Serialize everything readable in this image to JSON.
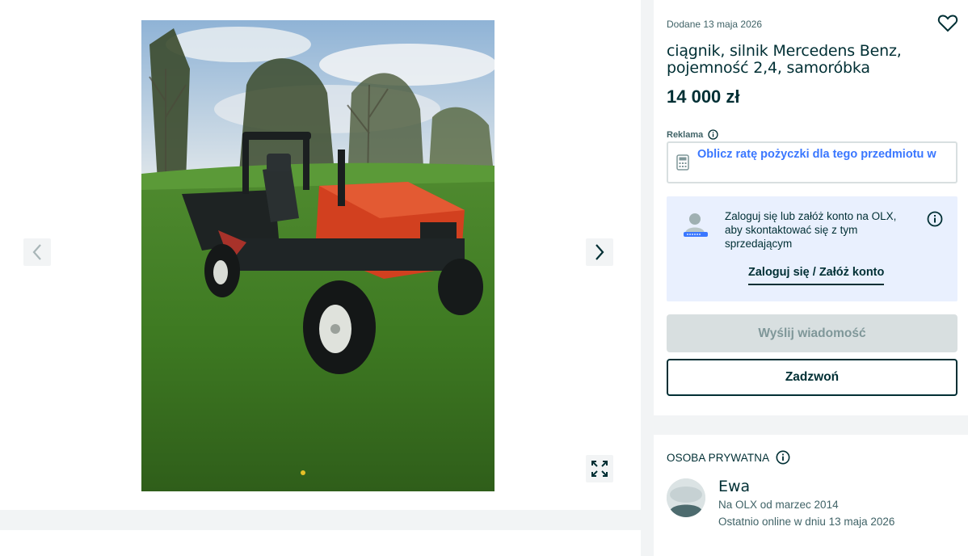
{
  "listing": {
    "posted": "Dodane 13 maja 2026",
    "title": "ciągnik, silnik Mercedens Benz, pojemność 2,4, samoróbka",
    "price": "14 000 zł"
  },
  "gallery": {
    "photo_icon": "tractor-photo",
    "prev_icon": "chevron-left-icon",
    "next_icon": "chevron-right-icon",
    "fullscreen_icon": "expand-icon"
  },
  "ad": {
    "label": "Reklama",
    "text": "Oblicz ratę pożyczki dla tego przedmiotu w"
  },
  "login_prompt": {
    "message": "Zaloguj się lub załóż konto na OLX, aby skontaktować się z tym sprzedającym",
    "link": "Zaloguj się / Załóż konto"
  },
  "actions": {
    "send_message": "Wyślij wiadomość",
    "call": "Zadzwoń"
  },
  "seller": {
    "type": "OSOBA PRYWATNA",
    "name": "Ewa",
    "since": "Na OLX od marzec 2014",
    "last_online": "Ostatnio online w dniu 13 maja 2026"
  },
  "colors": {
    "primary_text": "#002f34",
    "secondary_text": "#406367",
    "link_blue": "#3a77ff",
    "login_bg": "#e9f0fe",
    "disabled_btn": "#d8dfe0",
    "page_bg": "#f2f4f5"
  }
}
